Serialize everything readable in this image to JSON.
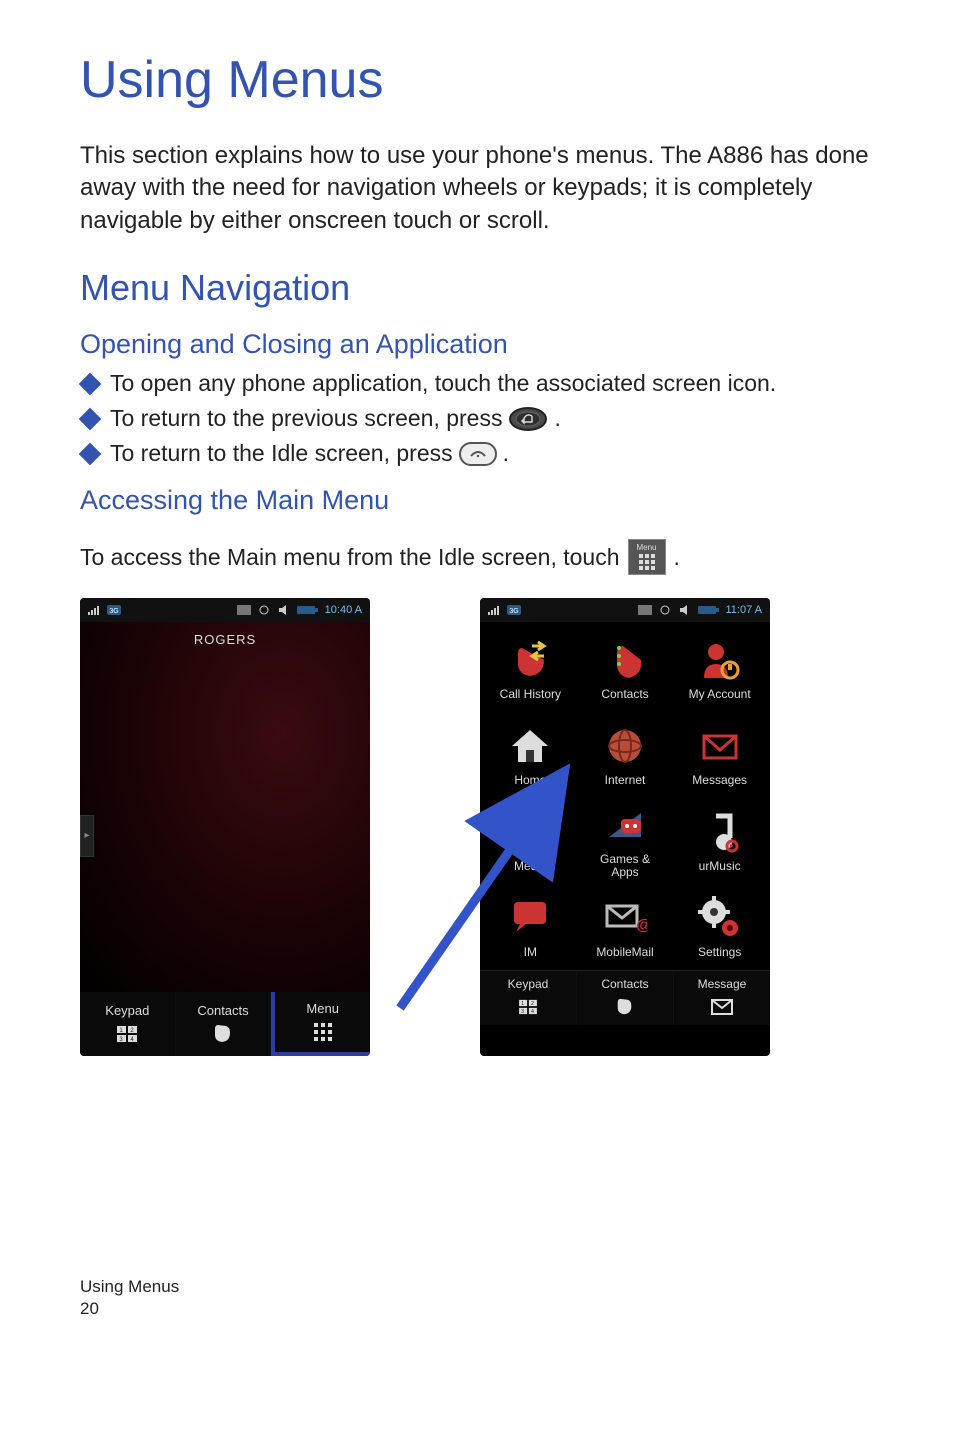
{
  "title": "Using Menus",
  "intro": "This section explains how to use your phone's menus. The A886 has done away with the need for navigation wheels or keypads; it is completely navigable by either onscreen touch or scroll.",
  "h2": "Menu Navigation",
  "h3a": "Opening and Closing an Application",
  "bullets": [
    "To open any phone application, touch the associated screen icon.",
    "To return to the previous screen, press",
    "To return to the Idle screen, press"
  ],
  "period": ".",
  "h3b": "Accessing the Main Menu",
  "access_text": "To access the Main menu from the Idle screen, touch",
  "menu_chip_label": "Menu",
  "status": {
    "idle_time": "10:40 A",
    "menu_time": "11:07 A"
  },
  "carrier": "ROGERS",
  "softkeys_idle": {
    "keypad": "Keypad",
    "contacts": "Contacts",
    "menu": "Menu"
  },
  "softkeys_menu": {
    "keypad": "Keypad",
    "contacts": "Contacts",
    "message": "Message"
  },
  "menu_items": [
    {
      "label": "Call History"
    },
    {
      "label": "Contacts"
    },
    {
      "label": "My Account"
    },
    {
      "label": "Home"
    },
    {
      "label": "Internet"
    },
    {
      "label": "Messages"
    },
    {
      "label": "Media"
    },
    {
      "label": "Games &\nApps"
    },
    {
      "label": "urMusic"
    },
    {
      "label": "IM"
    },
    {
      "label": "MobileMail"
    },
    {
      "label": "Settings"
    }
  ],
  "footer_section": "Using Menus",
  "footer_page": "20"
}
